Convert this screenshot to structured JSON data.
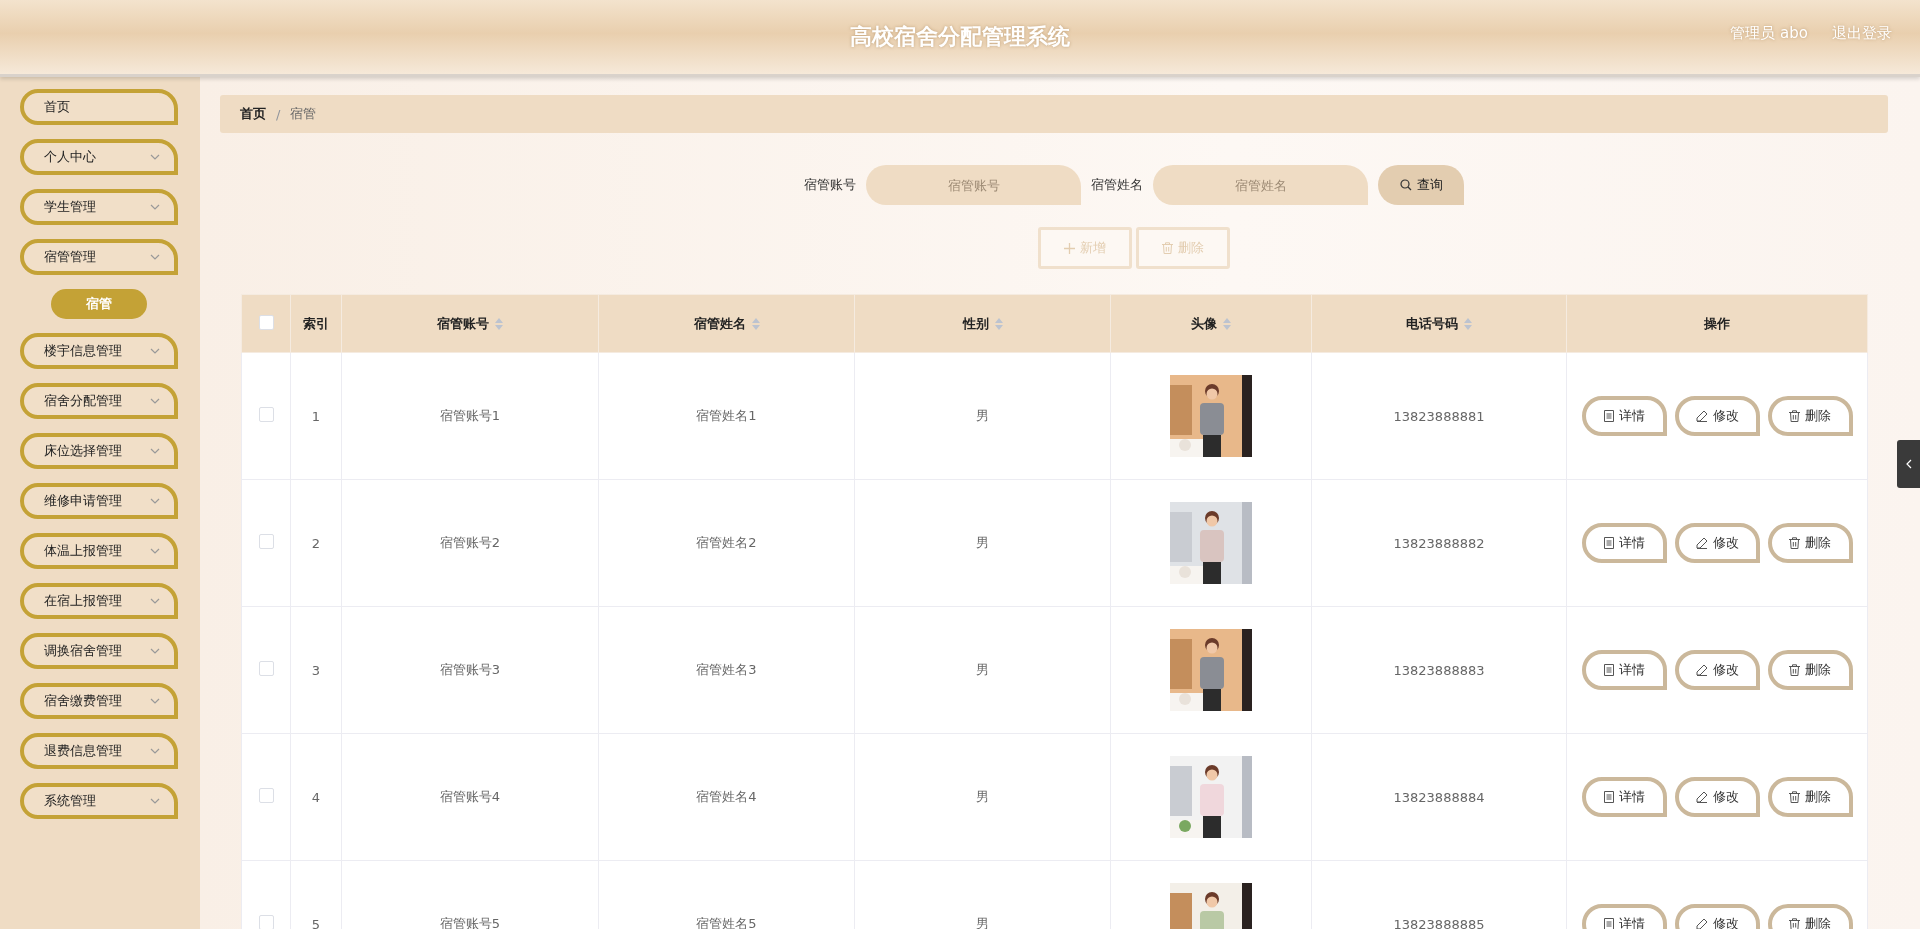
{
  "header": {
    "title": "高校宿舍分配管理系统",
    "user": "管理员 abo",
    "logout": "退出登录"
  },
  "sidebar": {
    "items": [
      {
        "label": "首页",
        "expandable": false
      },
      {
        "label": "个人中心",
        "expandable": true
      },
      {
        "label": "学生管理",
        "expandable": true
      },
      {
        "label": "宿管管理",
        "expandable": true,
        "children": [
          {
            "label": "宿管",
            "selected": true
          }
        ]
      },
      {
        "label": "楼宇信息管理",
        "expandable": true
      },
      {
        "label": "宿舍分配管理",
        "expandable": true
      },
      {
        "label": "床位选择管理",
        "expandable": true
      },
      {
        "label": "维修申请管理",
        "expandable": true
      },
      {
        "label": "体温上报管理",
        "expandable": true
      },
      {
        "label": "在宿上报管理",
        "expandable": true
      },
      {
        "label": "调换宿舍管理",
        "expandable": true
      },
      {
        "label": "宿舍缴费管理",
        "expandable": true
      },
      {
        "label": "退费信息管理",
        "expandable": true
      },
      {
        "label": "系统管理",
        "expandable": true
      }
    ]
  },
  "breadcrumb": {
    "items": [
      "首页",
      "宿管"
    ],
    "separator": "/"
  },
  "search": {
    "fields": [
      {
        "label": "宿管账号",
        "placeholder": "宿管账号"
      },
      {
        "label": "宿管姓名",
        "placeholder": "宿管姓名"
      }
    ],
    "button": "查询"
  },
  "actions": [
    {
      "kind": "add",
      "label": "新增"
    },
    {
      "kind": "delete",
      "label": "删除"
    }
  ],
  "table": {
    "select_all": {
      "checked": false
    },
    "columns": [
      {
        "label": "索引",
        "sortable": false
      },
      {
        "label": "宿管账号",
        "sortable": true
      },
      {
        "label": "宿管姓名",
        "sortable": true
      },
      {
        "label": "性别",
        "sortable": true
      },
      {
        "label": "头像",
        "sortable": true
      },
      {
        "label": "电话号码",
        "sortable": true
      },
      {
        "label": "操作",
        "sortable": false
      }
    ],
    "rows": [
      {
        "checked": false,
        "index": "1",
        "account": "宿管账号1",
        "name": "宿管姓名1",
        "gender": "男",
        "phone": "13823888881",
        "actions": [
          {
            "kind": "detail",
            "label": "详情"
          },
          {
            "kind": "edit",
            "label": "修改"
          },
          {
            "kind": "delete",
            "label": "删除"
          }
        ]
      },
      {
        "checked": false,
        "index": "2",
        "account": "宿管账号2",
        "name": "宿管姓名2",
        "gender": "男",
        "phone": "13823888882",
        "actions": [
          {
            "kind": "detail",
            "label": "详情"
          },
          {
            "kind": "edit",
            "label": "修改"
          },
          {
            "kind": "delete",
            "label": "删除"
          }
        ]
      },
      {
        "checked": false,
        "index": "3",
        "account": "宿管账号3",
        "name": "宿管姓名3",
        "gender": "男",
        "phone": "13823888883",
        "actions": [
          {
            "kind": "detail",
            "label": "详情"
          },
          {
            "kind": "edit",
            "label": "修改"
          },
          {
            "kind": "delete",
            "label": "删除"
          }
        ]
      },
      {
        "checked": false,
        "index": "4",
        "account": "宿管账号4",
        "name": "宿管姓名4",
        "gender": "男",
        "phone": "13823888884",
        "actions": [
          {
            "kind": "detail",
            "label": "详情"
          },
          {
            "kind": "edit",
            "label": "修改"
          },
          {
            "kind": "delete",
            "label": "删除"
          }
        ]
      },
      {
        "checked": false,
        "index": "5",
        "account": "宿管账号5",
        "name": "宿管姓名5",
        "gender": "男",
        "phone": "13823888885",
        "actions": [
          {
            "kind": "detail",
            "label": "详情"
          },
          {
            "kind": "edit",
            "label": "修改"
          },
          {
            "kind": "delete",
            "label": "删除"
          }
        ]
      }
    ]
  }
}
